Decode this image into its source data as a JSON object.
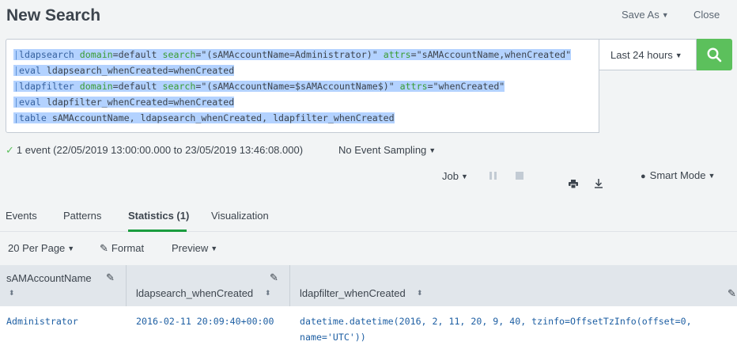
{
  "header": {
    "title": "New Search",
    "save_as": "Save As",
    "close": "Close"
  },
  "search": {
    "lines": [
      [
        {
          "t": "|",
          "c": "pipe"
        },
        {
          "t": "ldapsearch",
          "c": "cmd"
        },
        {
          "t": " ",
          "c": "str"
        },
        {
          "t": "domain",
          "c": "arg"
        },
        {
          "t": "=default ",
          "c": "str"
        },
        {
          "t": "search",
          "c": "arg"
        },
        {
          "t": "=\"(sAMAccountName=Administrator)\" ",
          "c": "str"
        },
        {
          "t": "attrs",
          "c": "arg"
        },
        {
          "t": "=\"sAMAccountName,whenCreated\"",
          "c": "str"
        }
      ],
      [
        {
          "t": "|",
          "c": "pipe"
        },
        {
          "t": "eval",
          "c": "cmd"
        },
        {
          "t": " ldapsearch_whenCreated=whenCreated",
          "c": "str"
        }
      ],
      [
        {
          "t": "|",
          "c": "pipe"
        },
        {
          "t": "ldapfilter",
          "c": "cmd"
        },
        {
          "t": " ",
          "c": "str"
        },
        {
          "t": "domain",
          "c": "arg"
        },
        {
          "t": "=default ",
          "c": "str"
        },
        {
          "t": "search",
          "c": "arg"
        },
        {
          "t": "=\"(sAMAccountName=$sAMAccountName$)\" ",
          "c": "str"
        },
        {
          "t": "attrs",
          "c": "arg"
        },
        {
          "t": "=\"whenCreated\"",
          "c": "str"
        }
      ],
      [
        {
          "t": "|",
          "c": "pipe"
        },
        {
          "t": "eval",
          "c": "cmd"
        },
        {
          "t": " ldapfilter_whenCreated=whenCreated",
          "c": "str"
        }
      ],
      [
        {
          "t": "|",
          "c": "pipe"
        },
        {
          "t": "table",
          "c": "cmd"
        },
        {
          "t": " sAMAccountName, ldapsearch_whenCreated, ldapfilter_whenCreated",
          "c": "str"
        }
      ]
    ],
    "time_range": "Last 24 hours"
  },
  "status": {
    "events": "1 event (22/05/2019 13:00:00.000 to 23/05/2019 13:46:08.000)",
    "sampling": "No Event Sampling"
  },
  "job_bar": {
    "job": "Job",
    "mode": "Smart Mode"
  },
  "tabs": [
    "Events",
    "Patterns",
    "Statistics (1)",
    "Visualization"
  ],
  "active_tab": 2,
  "toolbar": {
    "per_page": "20 Per Page",
    "format": "Format",
    "preview": "Preview"
  },
  "table": {
    "columns": [
      "sAMAccountName",
      "ldapsearch_whenCreated",
      "ldapfilter_whenCreated"
    ],
    "rows": [
      [
        "Administrator",
        "2016-02-11 20:09:40+00:00",
        "datetime.datetime(2016, 2, 11, 20, 9, 40, tzinfo=OffsetTzInfo(offset=0,",
        "name='UTC'))"
      ]
    ]
  },
  "colors": {
    "accent_green": "#5cc05c",
    "tab_underline": "#1a9c3e",
    "link_blue": "#1e5fa3",
    "selection": "#b3d2ff"
  }
}
